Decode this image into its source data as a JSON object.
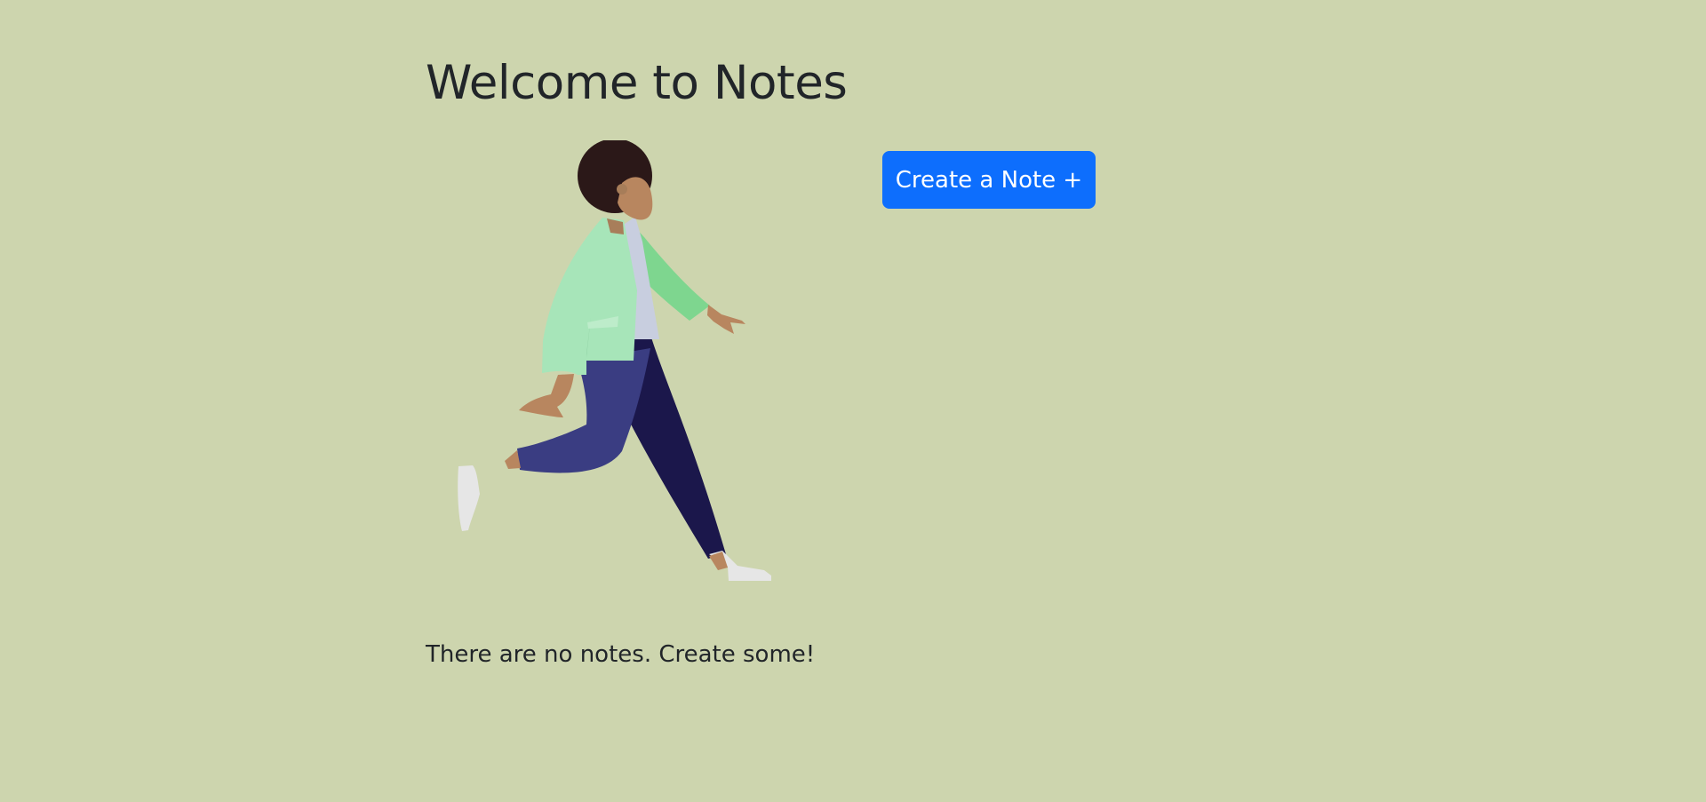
{
  "page": {
    "title": "Welcome to Notes",
    "background_color": "#cdd5ae"
  },
  "actions": {
    "create_note_label": "Create a Note +",
    "button_color": "#0d6efd"
  },
  "empty_state": {
    "message": "There are no notes. Create some!",
    "illustration": "walking-person-illustration"
  }
}
